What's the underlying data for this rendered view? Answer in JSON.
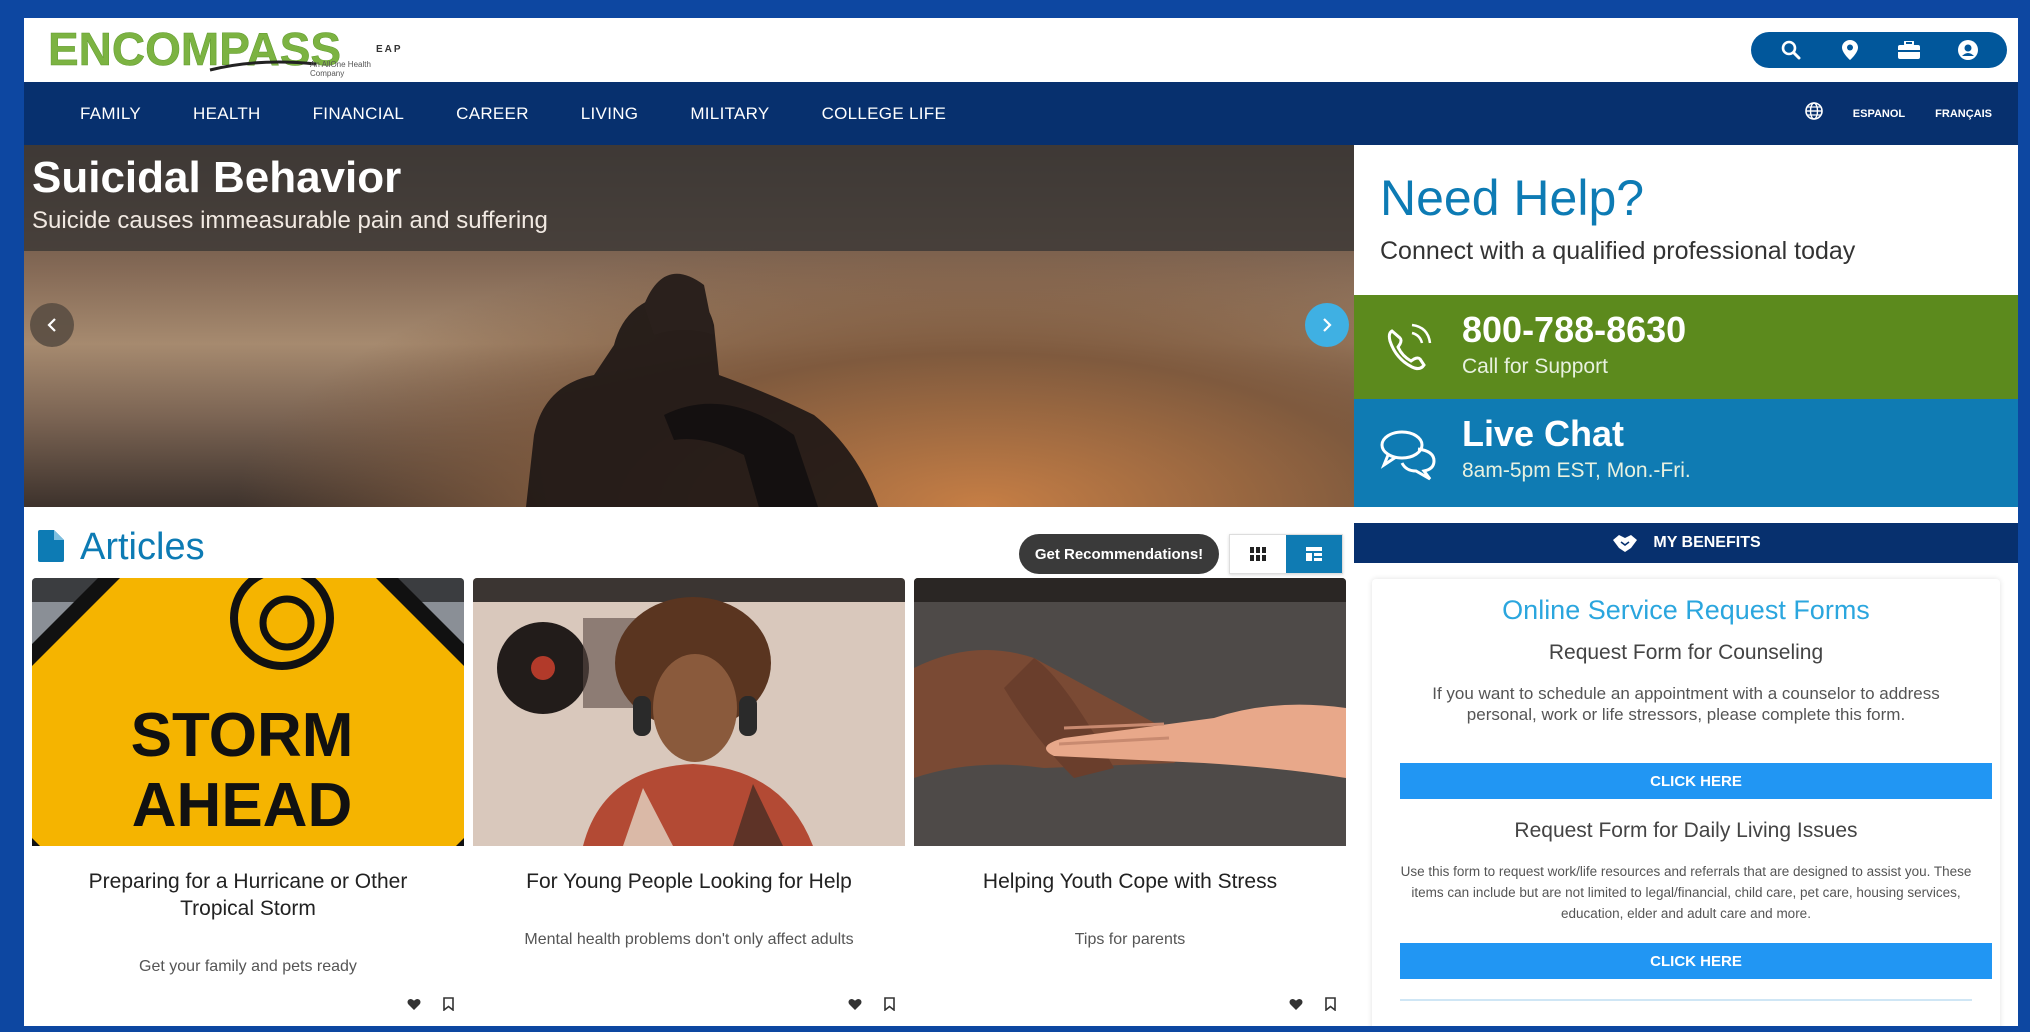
{
  "brand": {
    "name": "ENCOMPASS",
    "suffix": "EAP",
    "tagline": "An AllOne Health Company",
    "brand_color": "#7cb342"
  },
  "header_icons": [
    "search-icon",
    "map-marker-icon",
    "briefcase-icon",
    "user-circle-icon"
  ],
  "nav": {
    "items": [
      "FAMILY",
      "HEALTH",
      "FINANCIAL",
      "CAREER",
      "LIVING",
      "MILITARY",
      "COLLEGE LIFE"
    ],
    "languages": [
      "ESPANOL",
      "FRANÇAIS"
    ]
  },
  "hero": {
    "title": "Suicidal Behavior",
    "subtitle": "Suicide causes immeasurable pain and suffering"
  },
  "help": {
    "title": "Need Help?",
    "subtitle": "Connect with a qualified professional today",
    "phone": "800-788-8630",
    "phone_label": "Call for Support",
    "chat_title": "Live Chat",
    "chat_hours": "8am-5pm EST, Mon.-Fri.",
    "benefits_label": "MY BENEFITS"
  },
  "forms": {
    "title": "Online Service Request Forms",
    "counseling_title": "Request Form for Counseling",
    "counseling_desc": "If you want to schedule an appointment with a counselor to address personal, work or life stressors, please complete this form.",
    "counseling_button": "CLICK HERE",
    "living_title": "Request Form for Daily Living Issues",
    "living_desc": "Use this form to request work/life resources and referrals that are designed to assist you. These items can include but are not limited to legal/financial, child care, pet care, housing services, education, elder and adult care and more.",
    "living_button": "CLICK HERE"
  },
  "articles": {
    "title": "Articles",
    "recommend_button": "Get Recommendations!",
    "cards": [
      {
        "title": "Preparing for a Hurricane or Other Tropical Storm",
        "desc": "Get your family and pets ready",
        "sign_line1": "STORM",
        "sign_line2": "AHEAD"
      },
      {
        "title": "For Young People Looking for Help",
        "desc": "Mental health problems don't only affect adults"
      },
      {
        "title": "Helping Youth Cope with Stress",
        "desc": "Tips for parents"
      }
    ]
  },
  "colors": {
    "nav_bg": "#07306e",
    "accent_blue": "#0d7bb4",
    "call_green": "#5c8a1d",
    "button_blue": "#2196f3",
    "page_border": "#0d47a1"
  }
}
